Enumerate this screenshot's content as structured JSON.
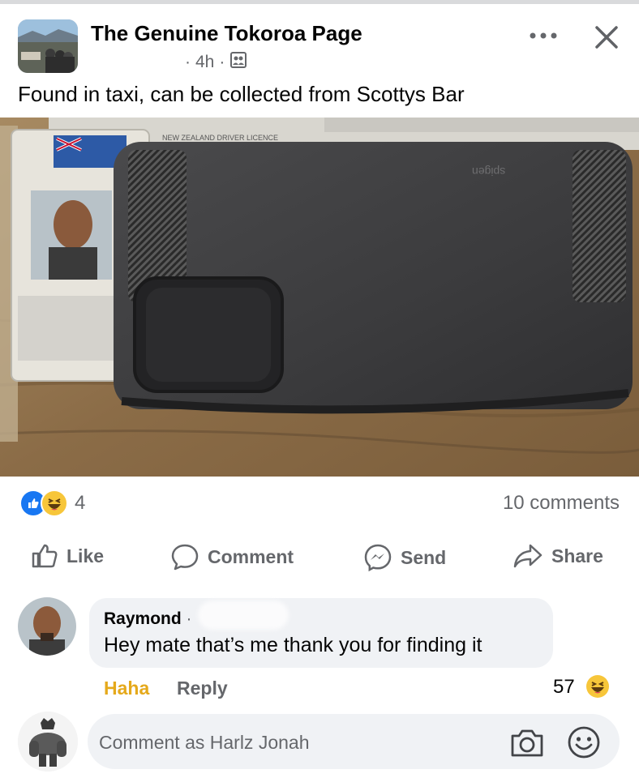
{
  "post": {
    "page_name": "The Genuine Tokoroa Page",
    "time_prefix": "·",
    "time": "4h",
    "time_suffix": "·",
    "caption": "Found in taxi, can be collected from Scottys Bar",
    "photo_texts": {
      "license_label": "NEW ZEALAND DRIVER LICENCE",
      "case_brand": "spigen"
    }
  },
  "engagement": {
    "reaction_count": "4",
    "comment_count": "10 comments"
  },
  "actions": {
    "like": "Like",
    "comment": "Comment",
    "send": "Send",
    "share": "Share"
  },
  "comment": {
    "author": "Raymond",
    "author_suffix": "·",
    "text": "Hey mate that’s me thank you for finding it",
    "haha_label": "Haha",
    "reply_label": "Reply",
    "reaction_count": "57"
  },
  "composer": {
    "placeholder": "Comment as Harlz Jonah"
  },
  "icons": [
    "more-icon",
    "close-icon",
    "privacy-icon",
    "like-reaction-icon",
    "haha-reaction-icon",
    "like-icon",
    "comment-icon",
    "messenger-icon",
    "share-icon",
    "camera-icon",
    "smile-icon"
  ],
  "colors": {
    "brand_blue": "#1877f2",
    "secondary_text": "#65676b",
    "haha_yellow": "#e5a91b",
    "bubble_bg": "#f0f2f5"
  }
}
